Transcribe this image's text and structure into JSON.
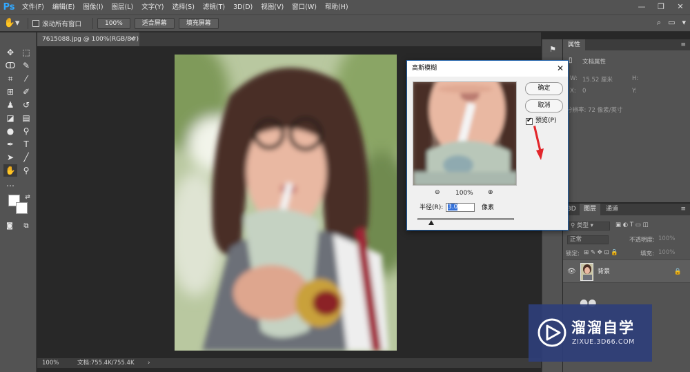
{
  "app": {
    "logo": "Ps",
    "menu": [
      "文件(F)",
      "编辑(E)",
      "图像(I)",
      "图层(L)",
      "文字(Y)",
      "选择(S)",
      "滤镜(T)",
      "3D(D)",
      "视图(V)",
      "窗口(W)",
      "帮助(H)"
    ],
    "window_controls": [
      "minimize-icon",
      "restore-icon",
      "close-icon"
    ]
  },
  "options": {
    "tool_icon": "hand-icon",
    "scroll_all_label": "滚动所有窗口",
    "zoom_100": "100%",
    "fit_screen": "适合屏幕",
    "fill_screen": "填充屏幕"
  },
  "document": {
    "tab_title": "7615088.jpg @ 100%(RGB/8#)",
    "tab_close": "×"
  },
  "status": {
    "zoom": "100%",
    "doc_size": "文档:755.4K/755.4K",
    "arrow": "›"
  },
  "properties": {
    "tab": "属性",
    "doc_props": "文档属性",
    "w_label": "W:",
    "w_value": "15.52 厘米",
    "h_label": "H:",
    "x_label": "X:",
    "x_value": "0",
    "y_label": "Y:",
    "resolution": "分辨率: 72 像素/英寸"
  },
  "layers": {
    "tabs": [
      "3D",
      "图层",
      "通道"
    ],
    "kind_filter": "类型",
    "blend_mode": "正常",
    "opacity_label": "不透明度:",
    "opacity_value": "100%",
    "lock_label": "锁定:",
    "fill_label": "填充:",
    "fill_value": "100%",
    "layer_name": "背景"
  },
  "dialog": {
    "title": "高斯模糊",
    "close": "✕",
    "ok": "确定",
    "cancel": "取消",
    "preview_label": "预览(P)",
    "preview_checked": true,
    "zoom_out": "⊖",
    "zoom_value": "100%",
    "zoom_in": "⊕",
    "radius_label": "半径(R):",
    "radius_value": "3.0",
    "radius_unit": "像素"
  },
  "watermark": {
    "title": "溜溜自学",
    "url": "ZIXUE.3D66.COM"
  },
  "colors": {
    "ps_blue": "#31a8ff",
    "panel_gray": "#535353",
    "dark_bg": "#282828",
    "annotation_red": "#e2262b",
    "watermark_blue": "#2e3e78"
  }
}
